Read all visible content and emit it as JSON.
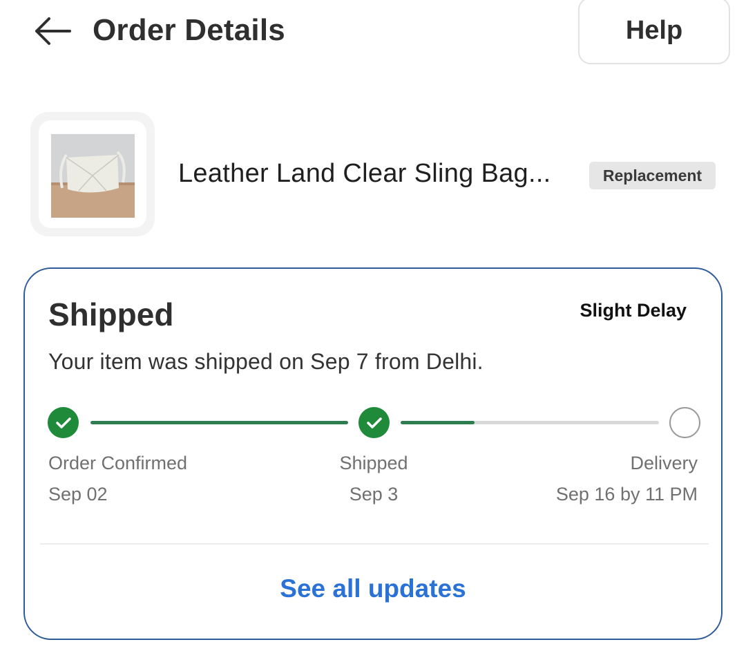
{
  "header": {
    "title": "Order Details",
    "help_label": "Help",
    "back_icon": "arrow-left-icon"
  },
  "product": {
    "name": "Leather Land Clear Sling Bag...",
    "badge": "Replacement",
    "image": "product-thumbnail"
  },
  "status": {
    "title": "Shipped",
    "delay": "Slight Delay",
    "description": "Your item was shipped on Sep 7 from Delhi.",
    "progress_fraction": 0.56,
    "steps": [
      {
        "label": "Order Confirmed",
        "date": "Sep 02",
        "state": "done"
      },
      {
        "label": "Shipped",
        "date": "Sep 3",
        "state": "done"
      },
      {
        "label": "Delivery",
        "date": "Sep 16 by 11 PM",
        "state": "pending"
      }
    ],
    "see_all_label": "See all updates"
  },
  "colors": {
    "accent_blue": "#2a72d6",
    "card_border": "#2d5b9a",
    "success_green": "#1f8a3a",
    "track_gray": "#d9d9d9"
  }
}
